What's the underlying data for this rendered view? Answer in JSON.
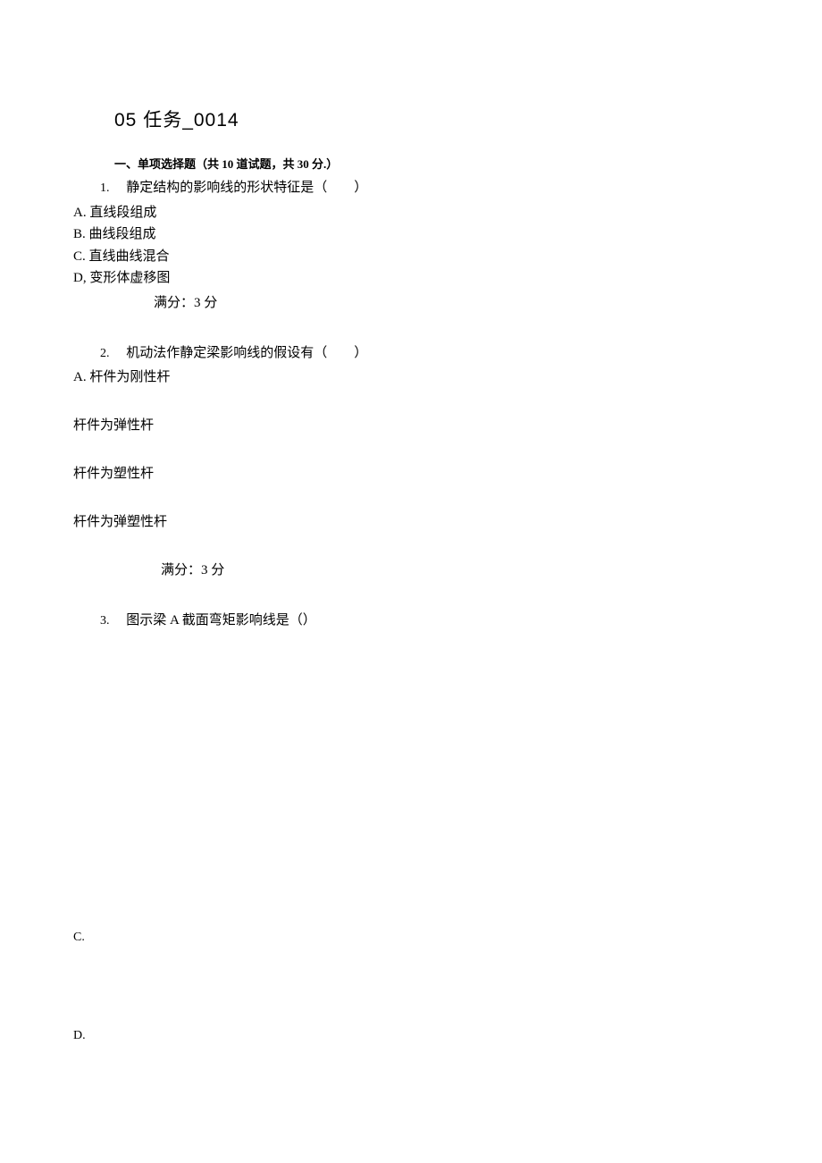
{
  "title": "05 任务_0014",
  "sectionHeader": "一、单项选择题（共 10 道试题，共 30 分.）",
  "q1": {
    "num": "1.",
    "stem": "静定结构的影响线的形状特征是（  ）",
    "optA": "A. 直线段组成",
    "optB": "B. 曲线段组成",
    "optC": "C. 直线曲线混合",
    "optD": "D, 变形体虚移图",
    "score": "满分：3 分"
  },
  "q2": {
    "num": "2.",
    "stem": "机动法作静定梁影响线的假设有（  ）",
    "optA": "A. 杆件为刚性杆",
    "optB": "杆件为弹性杆",
    "optC": "杆件为塑性杆",
    "optD": "杆件为弹塑性杆",
    "score": "满分：3 分"
  },
  "q3": {
    "num": "3.",
    "stem": "图示梁 A 截面弯矩影响线是（）",
    "optC": "C.",
    "optD": "D."
  }
}
